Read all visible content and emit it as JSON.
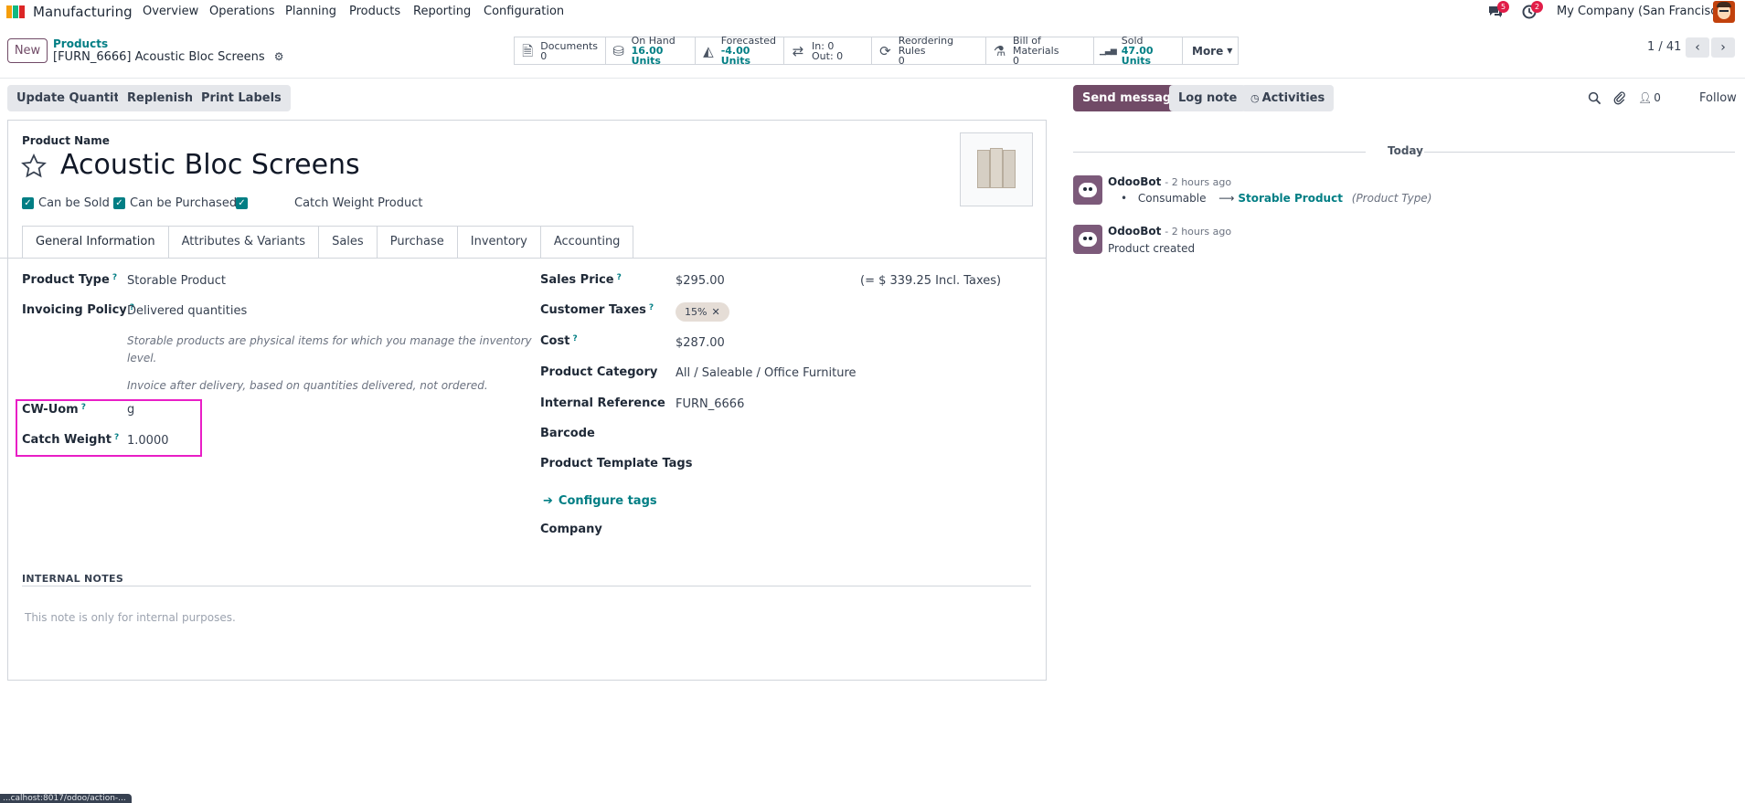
{
  "navbar": {
    "app_name": "Manufacturing",
    "menu": [
      "Overview",
      "Operations",
      "Planning",
      "Products",
      "Reporting",
      "Configuration"
    ],
    "messages_badge": "5",
    "activities_badge": "2",
    "company": "My Company (San Francisco)"
  },
  "control_panel": {
    "new_label": "New",
    "breadcrumb_parent": "Products",
    "breadcrumb_current": "[FURN_6666] Acoustic Bloc Screens",
    "smart_buttons": [
      {
        "label": "Documents",
        "value": "0",
        "icon": "file-icon",
        "glyph": "🗎"
      },
      {
        "label": "On Hand",
        "value": "16.00 Units",
        "icon": "cubes-icon",
        "glyph": "⛁"
      },
      {
        "label": "Forecasted",
        "value": "-4.00 Units",
        "icon": "area-chart-icon",
        "glyph": "◭"
      },
      {
        "label": "In: 0",
        "value": "Out: 0",
        "icon": "exchange-icon",
        "glyph": "⇄"
      },
      {
        "label": "Reordering Rules",
        "value": "0",
        "icon": "refresh-icon",
        "glyph": "⟳"
      },
      {
        "label": "Bill of Materials",
        "value": "0",
        "icon": "flask-icon",
        "glyph": "⚗"
      },
      {
        "label": "Sold",
        "value": "47.00 Units",
        "icon": "signal-icon",
        "glyph": "▁▃▅"
      }
    ],
    "more_label": "More",
    "pager": "1 / 41"
  },
  "actions": {
    "update_quantity": "Update Quantity",
    "replenish": "Replenish",
    "print_labels": "Print Labels"
  },
  "form": {
    "product_name_label": "Product Name",
    "product_name": "Acoustic Bloc Screens",
    "can_be_sold": "Can be Sold",
    "can_be_purchased": "Can be Purchased",
    "catch_weight_product": "Catch Weight Product",
    "tabs": [
      "General Information",
      "Attributes & Variants",
      "Sales",
      "Purchase",
      "Inventory",
      "Accounting"
    ],
    "left": {
      "product_type_label": "Product Type",
      "product_type": "Storable Product",
      "invoicing_policy_label": "Invoicing Policy",
      "invoicing_policy": "Delivered quantities",
      "hint_storable_1": "Storable products are physical items for which you manage the inventory",
      "hint_storable_2": "level.",
      "hint_invoice": "Invoice after delivery, based on quantities delivered, not ordered.",
      "cw_uom_label": "CW-Uom",
      "cw_uom": "g",
      "catch_weight_label": "Catch Weight",
      "catch_weight": "1.0000"
    },
    "right": {
      "sales_price_label": "Sales Price",
      "sales_price": "$295.00",
      "incl_taxes": "(= $ 339.25 Incl. Taxes)",
      "customer_taxes_label": "Customer Taxes",
      "customer_tax_tag": "15%",
      "cost_label": "Cost",
      "cost": "$287.00",
      "product_category_label": "Product Category",
      "product_category": "All / Saleable / Office Furniture",
      "internal_reference_label": "Internal Reference",
      "internal_reference": "FURN_6666",
      "barcode_label": "Barcode",
      "template_tags_label": "Product Template Tags",
      "configure_tags": "Configure tags",
      "company_label": "Company"
    },
    "internal_notes_title": "INTERNAL NOTES",
    "internal_notes_placeholder": "This note is only for internal purposes."
  },
  "chatter": {
    "send_message": "Send message",
    "log_note": "Log note",
    "activities": "Activities",
    "followers_count": "0",
    "follow": "Follow",
    "today": "Today",
    "messages": [
      {
        "author": "OdooBot",
        "time": "- 2 hours ago",
        "from": "Consumable",
        "to": "Storable Product",
        "field": "(Product Type)"
      },
      {
        "author": "OdooBot",
        "time": "- 2 hours ago",
        "body": "Product created"
      }
    ]
  },
  "status_bar": "...calhost:8017/odoo/action-..."
}
